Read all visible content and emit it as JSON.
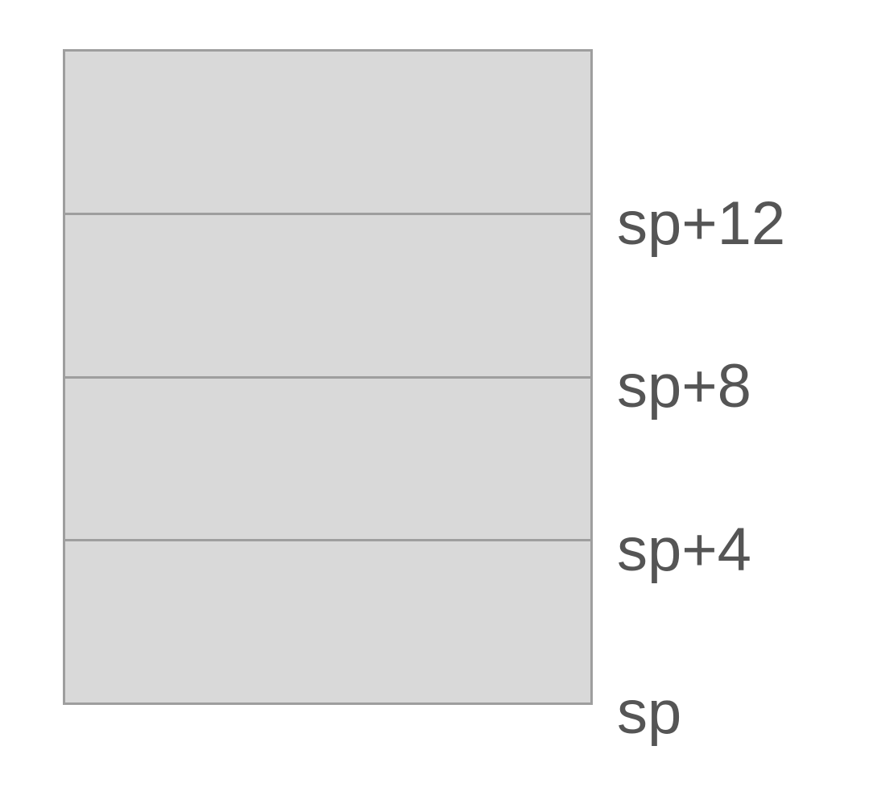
{
  "diagram": {
    "slots": [
      {
        "id": "slot-top"
      },
      {
        "id": "slot-sp-plus-8"
      },
      {
        "id": "slot-sp-plus-4"
      },
      {
        "id": "slot-sp"
      }
    ],
    "labels": [
      "sp+12",
      "sp+8",
      "sp+4",
      "sp"
    ],
    "colors": {
      "slot_fill": "#d9d9d9",
      "slot_border": "#9e9e9e",
      "label_text": "#555555"
    }
  }
}
